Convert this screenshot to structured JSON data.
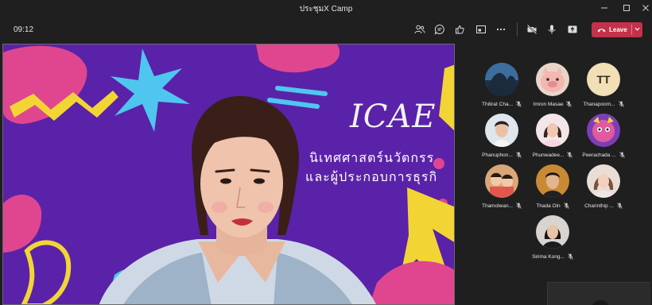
{
  "window": {
    "title": "ประชุมX Camp",
    "controls": [
      "minimize",
      "maximize",
      "close"
    ]
  },
  "toolbar": {
    "timer": "09:12",
    "buttons": [
      "people-icon",
      "chat-icon",
      "reactions-icon",
      "rooms-icon",
      "more-icon",
      "camera-off-icon",
      "mic-icon",
      "share-icon"
    ],
    "leave_label": "Leave",
    "leave_color": "#c4314b"
  },
  "video": {
    "logo_text": "ICAE",
    "banner_line1": "นิเทศศาสตร์นวัตกรร",
    "banner_line2": "และผู้ประกอบการธุรกิ",
    "background_color": "#5a22a8"
  },
  "participants": [
    {
      "name": "Thitirat Cha...",
      "avatar": "photo",
      "muted": true
    },
    {
      "name": "Imron Masae",
      "avatar": "photo",
      "muted": true
    },
    {
      "name": "Thanapoom...",
      "avatar": "initials",
      "initials": "TT",
      "muted": true
    },
    {
      "name": "Phanuphon...",
      "avatar": "photo",
      "muted": true
    },
    {
      "name": "Phunwadee...",
      "avatar": "photo",
      "muted": true
    },
    {
      "name": "Peerachada ...",
      "avatar": "photo",
      "muted": true
    },
    {
      "name": "Thamolwan...",
      "avatar": "photo",
      "muted": true
    },
    {
      "name": "Thada Oin",
      "avatar": "photo",
      "muted": true
    },
    {
      "name": "Charinthip ...",
      "avatar": "photo",
      "muted": true
    },
    {
      "name": "Sirima Kong...",
      "avatar": "photo",
      "muted": true
    }
  ]
}
